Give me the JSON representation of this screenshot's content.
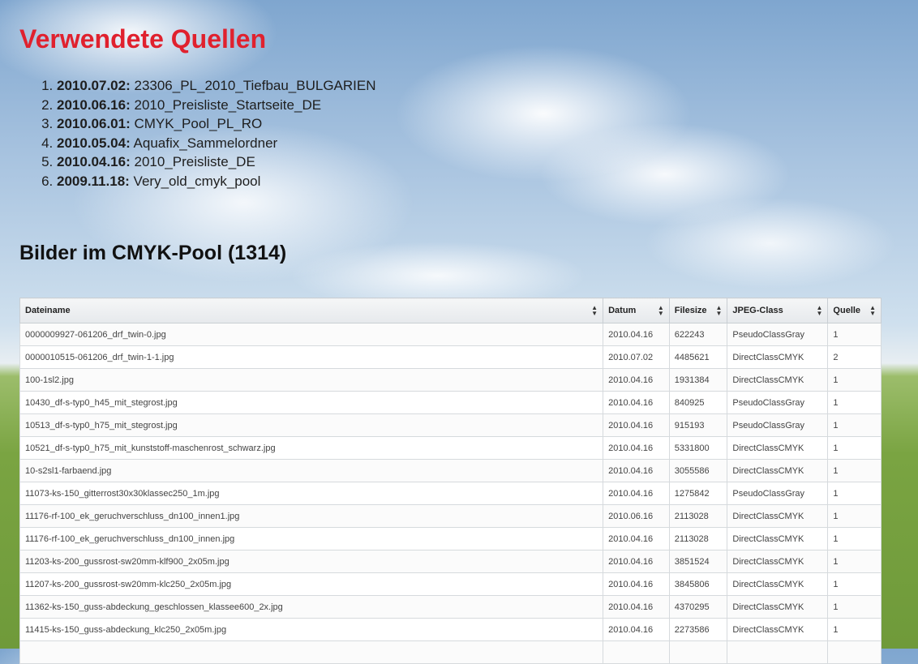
{
  "headline": "Verwendete Quellen",
  "sources": [
    {
      "date": "2010.07.02:",
      "name": "23306_PL_2010_Tiefbau_BULGARIEN"
    },
    {
      "date": "2010.06.16:",
      "name": "2010_Preisliste_Startseite_DE"
    },
    {
      "date": "2010.06.01:",
      "name": "CMYK_Pool_PL_RO"
    },
    {
      "date": "2010.05.04:",
      "name": "Aquafix_Sammelordner"
    },
    {
      "date": "2010.04.16:",
      "name": "2010_Preisliste_DE"
    },
    {
      "date": "2009.11.18:",
      "name": "Very_old_cmyk_pool"
    }
  ],
  "pool": {
    "title": "Bilder im CMYK-Pool",
    "count": "(1314)"
  },
  "table": {
    "headers": [
      "Dateiname",
      "Datum",
      "Filesize",
      "JPEG-Class",
      "Quelle"
    ],
    "rows": [
      [
        "0000009927-061206_drf_twin-0.jpg",
        "2010.04.16",
        "622243",
        "PseudoClassGray",
        "1"
      ],
      [
        "0000010515-061206_drf_twin-1-1.jpg",
        "2010.07.02",
        "4485621",
        "DirectClassCMYK",
        "2"
      ],
      [
        "100-1sl2.jpg",
        "2010.04.16",
        "1931384",
        "DirectClassCMYK",
        "1"
      ],
      [
        "10430_df-s-typ0_h45_mit_stegrost.jpg",
        "2010.04.16",
        "840925",
        "PseudoClassGray",
        "1"
      ],
      [
        "10513_df-s-typ0_h75_mit_stegrost.jpg",
        "2010.04.16",
        "915193",
        "PseudoClassGray",
        "1"
      ],
      [
        "10521_df-s-typ0_h75_mit_kunststoff-maschenrost_schwarz.jpg",
        "2010.04.16",
        "5331800",
        "DirectClassCMYK",
        "1"
      ],
      [
        "10-s2sl1-farbaend.jpg",
        "2010.04.16",
        "3055586",
        "DirectClassCMYK",
        "1"
      ],
      [
        "11073-ks-150_gitterrost30x30klassec250_1m.jpg",
        "2010.04.16",
        "1275842",
        "PseudoClassGray",
        "1"
      ],
      [
        "11176-rf-100_ek_geruchverschluss_dn100_innen1.jpg",
        "2010.06.16",
        "2113028",
        "DirectClassCMYK",
        "1"
      ],
      [
        "11176-rf-100_ek_geruchverschluss_dn100_innen.jpg",
        "2010.04.16",
        "2113028",
        "DirectClassCMYK",
        "1"
      ],
      [
        "11203-ks-200_gussrost-sw20mm-klf900_2x05m.jpg",
        "2010.04.16",
        "3851524",
        "DirectClassCMYK",
        "1"
      ],
      [
        "11207-ks-200_gussrost-sw20mm-klc250_2x05m.jpg",
        "2010.04.16",
        "3845806",
        "DirectClassCMYK",
        "1"
      ],
      [
        "11362-ks-150_guss-abdeckung_geschlossen_klassee600_2x.jpg",
        "2010.04.16",
        "4370295",
        "DirectClassCMYK",
        "1"
      ],
      [
        "11415-ks-150_guss-abdeckung_klc250_2x05m.jpg",
        "2010.04.16",
        "2273586",
        "DirectClassCMYK",
        "1"
      ],
      [
        "",
        "",
        "",
        "",
        ""
      ]
    ]
  }
}
